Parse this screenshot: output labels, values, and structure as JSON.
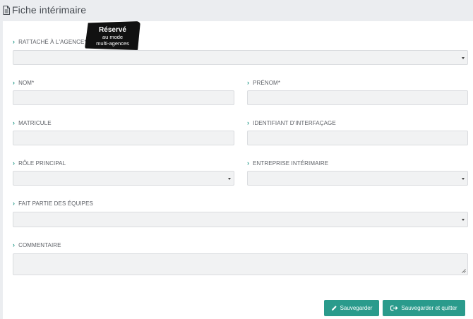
{
  "page": {
    "title": "Fiche intérimaire",
    "icon": "document-icon"
  },
  "badge": {
    "title": "Réservé",
    "line2": "au mode",
    "line3": "multi-agences"
  },
  "form": {
    "agency": {
      "label": "RATTACHÉ À L'AGENCE*",
      "value": ""
    },
    "last_name": {
      "label": "NOM*",
      "value": ""
    },
    "first_name": {
      "label": "PRÉNOM*",
      "value": ""
    },
    "employee_id": {
      "label": "MATRICULE",
      "value": ""
    },
    "interface_id": {
      "label": "IDENTIFIANT D'INTERFAÇAGE",
      "value": ""
    },
    "main_role": {
      "label": "RÔLE PRINCIPAL",
      "value": ""
    },
    "agency_company": {
      "label": "ENTREPRISE INTÉRIMAIRE",
      "value": ""
    },
    "teams": {
      "label": "FAIT PARTIE DES ÉQUIPES",
      "value": ""
    },
    "comment": {
      "label": "COMMENTAIRE",
      "value": ""
    }
  },
  "actions": {
    "save": {
      "label": "Sauvegarder",
      "icon": "pencil-icon"
    },
    "save_quit": {
      "label": "Sauvegarder et quitter",
      "icon": "exit-link-icon"
    }
  },
  "colors": {
    "accent": "#2a9b8c",
    "background": "#ebedf0",
    "field": "#f1f2f3"
  }
}
